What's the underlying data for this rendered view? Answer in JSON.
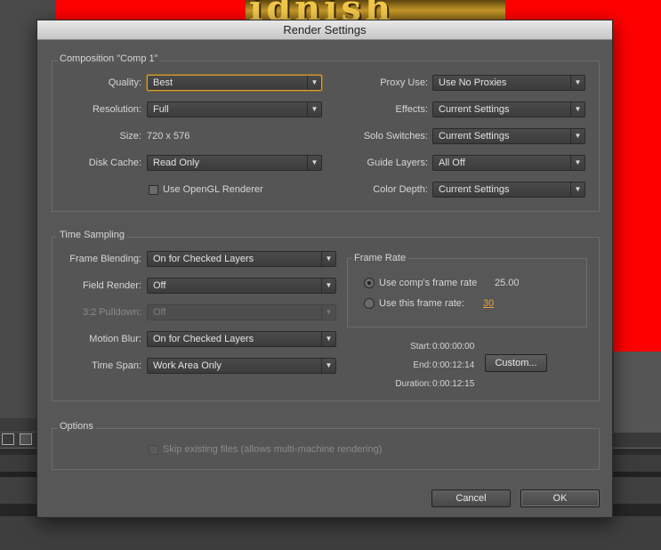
{
  "dialog": {
    "title": "Render Settings"
  },
  "composition": {
    "title": "Composition \"Comp 1\"",
    "quality": {
      "label": "Quality:",
      "value": "Best"
    },
    "resolution": {
      "label": "Resolution:",
      "value": "Full"
    },
    "size": {
      "label": "Size:",
      "value": "720 x 576"
    },
    "disk_cache": {
      "label": "Disk Cache:",
      "value": "Read Only"
    },
    "opengl": {
      "label": "Use OpenGL Renderer",
      "checked": false
    },
    "proxy_use": {
      "label": "Proxy Use:",
      "value": "Use No Proxies"
    },
    "effects": {
      "label": "Effects:",
      "value": "Current Settings"
    },
    "solo_switches": {
      "label": "Solo Switches:",
      "value": "Current Settings"
    },
    "guide_layers": {
      "label": "Guide Layers:",
      "value": "All Off"
    },
    "color_depth": {
      "label": "Color Depth:",
      "value": "Current Settings"
    }
  },
  "time_sampling": {
    "title": "Time Sampling",
    "frame_blending": {
      "label": "Frame Blending:",
      "value": "On for Checked Layers"
    },
    "field_render": {
      "label": "Field Render:",
      "value": "Off"
    },
    "pulldown": {
      "label": "3:2 Pulldown:",
      "value": "Off",
      "disabled": true
    },
    "motion_blur": {
      "label": "Motion Blur:",
      "value": "On for Checked Layers"
    },
    "time_span": {
      "label": "Time Span:",
      "value": "Work Area Only"
    },
    "frame_rate": {
      "title": "Frame Rate",
      "use_comp_label": "Use comp's frame rate",
      "comp_rate": "25.00",
      "use_this_label": "Use this frame rate:",
      "this_rate": "30",
      "selected": "comp"
    },
    "start": {
      "label": "Start:",
      "value": "0:00:00:00"
    },
    "end": {
      "label": "End:",
      "value": "0:00:12:14"
    },
    "duration": {
      "label": "Duration:",
      "value": "0:00:12:15"
    },
    "custom_button": "Custom..."
  },
  "options": {
    "title": "Options",
    "skip_existing": {
      "label": "Skip existing files (allows multi-machine rendering)",
      "disabled": true
    }
  },
  "buttons": {
    "cancel": "Cancel",
    "ok": "OK"
  },
  "colors": {
    "accent_focus": "#d8a13a",
    "link_orange": "#e8a534",
    "background_red": "#ff0000"
  }
}
